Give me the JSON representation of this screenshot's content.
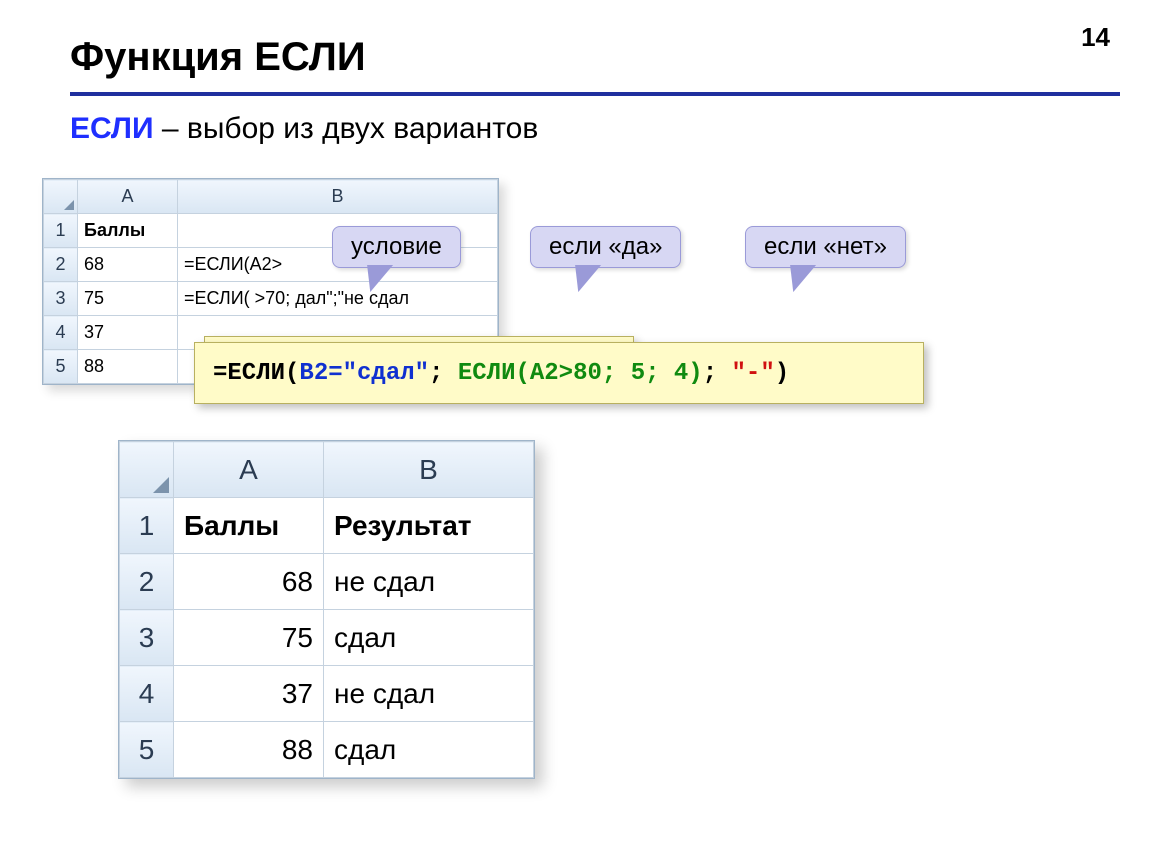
{
  "page_number": "14",
  "title": "Функция ЕСЛИ",
  "subtitle_keyword": "ЕСЛИ",
  "subtitle_rest": " – выбор из двух вариантов",
  "callouts": {
    "condition": "условие",
    "if_yes": "если «да»",
    "if_no": "если «нет»"
  },
  "sheet1": {
    "col_headers": {
      "A": "A",
      "B": "B"
    },
    "header_row_label": "1",
    "header_cell": "Баллы",
    "rows": [
      {
        "n": "2",
        "A": "68",
        "B": "=ЕСЛИ(A2>"
      },
      {
        "n": "3",
        "A": "75",
        "B": "=ЕСЛИ(      >70;     дал\";\"не сдал"
      },
      {
        "n": "4",
        "A": "37",
        "B": ""
      },
      {
        "n": "5",
        "A": "88",
        "B": ""
      }
    ]
  },
  "formula": {
    "p1": "=ЕСЛИ(",
    "p2": "B2=\"сдал\"",
    "p3": "; ",
    "p4": "ЕСЛИ(A2>80; 5; 4)",
    "p5": "; ",
    "p6": "\"-\"",
    "p7": ")"
  },
  "sheet2": {
    "col_headers": {
      "A": "A",
      "B": "B"
    },
    "header_row_label": "1",
    "header_A": "Баллы",
    "header_B": "Результат",
    "rows": [
      {
        "n": "2",
        "A": "68",
        "B": "не сдал"
      },
      {
        "n": "3",
        "A": "75",
        "B": "сдал"
      },
      {
        "n": "4",
        "A": "37",
        "B": "не сдал"
      },
      {
        "n": "5",
        "A": "88",
        "B": "сдал"
      }
    ]
  }
}
